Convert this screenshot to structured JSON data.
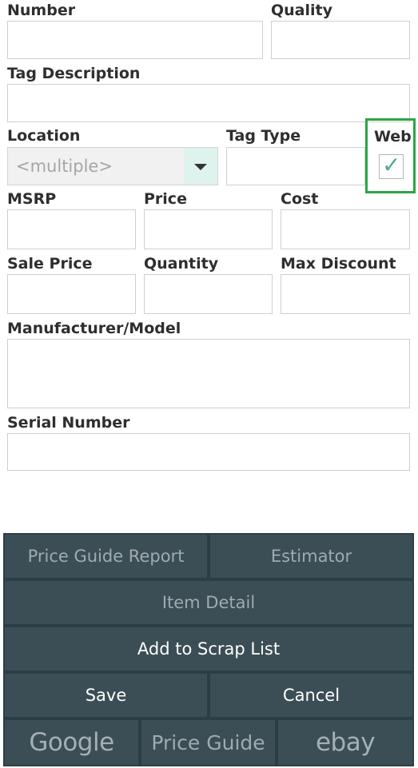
{
  "form": {
    "number_label": "Number",
    "quality_label": "Quality",
    "tag_description_label": "Tag Description",
    "location_label": "Location",
    "location_value": "<multiple>",
    "tag_type_label": "Tag Type",
    "web_label": "Web",
    "web_checked": true,
    "web_check_mark": "✓",
    "msrp_label": "MSRP",
    "price_label": "Price",
    "cost_label": "Cost",
    "sale_price_label": "Sale Price",
    "quantity_label": "Quantity",
    "max_discount_label": "Max Discount",
    "manufacturer_model_label": "Manufacturer/Model",
    "serial_number_label": "Serial Number"
  },
  "buttons": {
    "price_guide_report": "Price Guide Report",
    "estimator": "Estimator",
    "item_detail": "Item Detail",
    "add_to_scrap_list": "Add to Scrap List",
    "save": "Save",
    "cancel": "Cancel",
    "google": "Google",
    "price_guide": "Price Guide",
    "ebay": "ebay"
  },
  "colors": {
    "button_bg": "#3b4e55",
    "button_area_bg": "#2c3e45",
    "highlight_frame": "#28a745",
    "dropdown_arrow_bg": "#dff3ee",
    "check_mark": "#4faa8e"
  }
}
